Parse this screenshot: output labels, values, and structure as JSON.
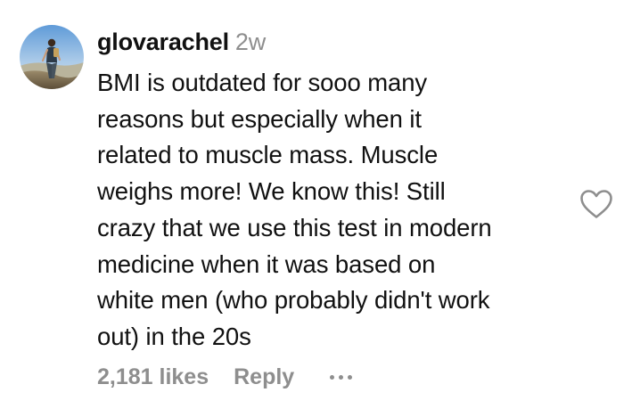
{
  "comment": {
    "username": "glovarachel",
    "timestamp": "2w",
    "text_lines": [
      "BMI is outdated for sooo many",
      "reasons but especially when it",
      "related to muscle mass. Muscle",
      "weighs more! We know this! Still",
      "crazy that we use this test in modern",
      "medicine when it was based on",
      "white men (who probably didn't work",
      "out) in the 20s"
    ],
    "likes": "2,181 likes",
    "reply_label": "Reply",
    "like_icon": "heart-outline-icon",
    "more_icon": "more-horizontal-icon"
  },
  "colors": {
    "text": "#111111",
    "muted": "#8e8e8e",
    "background": "#ffffff"
  }
}
